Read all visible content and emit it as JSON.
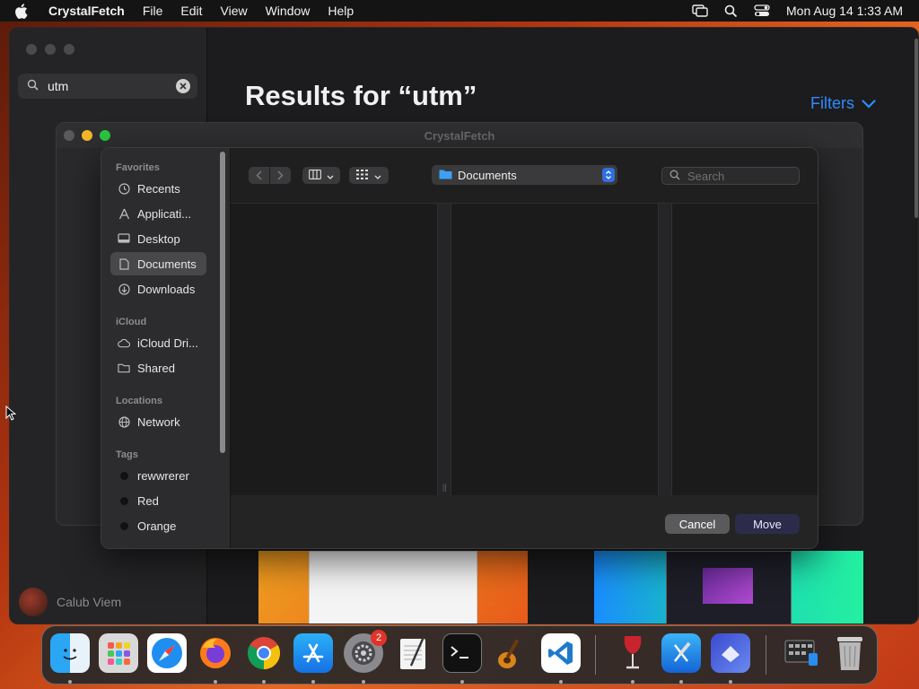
{
  "menubar": {
    "app_name": "CrystalFetch",
    "items": [
      "File",
      "Edit",
      "View",
      "Window",
      "Help"
    ],
    "clock": "Mon Aug 14  1:33 AM"
  },
  "main": {
    "search_value": "utm",
    "results_title": "Results for “utm”",
    "filters_label": "Filters",
    "user_name": "Calub Viem",
    "accent_color": "#2f8bff"
  },
  "back_dialog": {
    "title": "CrystalFetch"
  },
  "file_dialog": {
    "favorites_header": "Favorites",
    "favorites": [
      "Recents",
      "Applicati...",
      "Desktop",
      "Documents",
      "Downloads"
    ],
    "icloud_header": "iCloud",
    "icloud": [
      "iCloud Dri...",
      "Shared"
    ],
    "locations_header": "Locations",
    "locations": [
      "Network"
    ],
    "tags_header": "Tags",
    "tags": [
      "rewwrerer",
      "Red",
      "Orange"
    ],
    "location": "Documents",
    "search_placeholder": "Search",
    "cancel_label": "Cancel",
    "move_label": "Move"
  },
  "dock": {
    "settings_badge": "2"
  }
}
